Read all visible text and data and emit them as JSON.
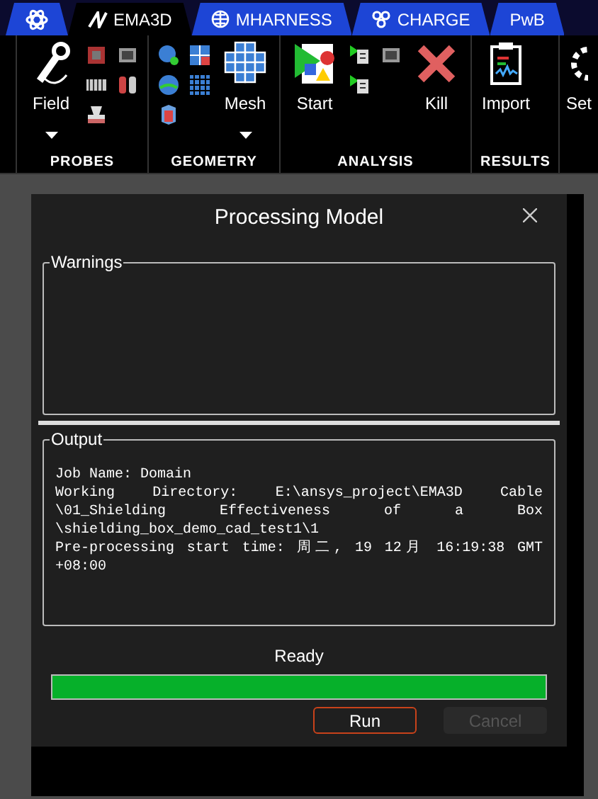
{
  "tabs": [
    {
      "kind": "logo",
      "selected": false
    },
    {
      "kind": "text",
      "label": "EMA3D",
      "selected": true
    },
    {
      "kind": "text",
      "label": "MHARNESS",
      "selected": false
    },
    {
      "kind": "text",
      "label": "CHARGE",
      "selected": false
    },
    {
      "kind": "text",
      "label": "PwB",
      "selected": false
    }
  ],
  "ribbon": {
    "groups": [
      {
        "label": "PROBES",
        "large": {
          "label": "Field",
          "dropdown": true
        }
      },
      {
        "label": "GEOMETRY",
        "large": {
          "label": "Mesh",
          "dropdown": true
        }
      },
      {
        "label": "ANALYSIS",
        "large": {
          "label": "Start",
          "dropdown": false
        },
        "extra": {
          "label": "Kill",
          "dropdown": false
        }
      },
      {
        "label": "RESULTS",
        "large": {
          "label": "Import",
          "dropdown": false
        }
      }
    ],
    "partial_button": {
      "label": "Set"
    }
  },
  "dialog": {
    "title": "Processing Model",
    "warnings": {
      "label": "Warnings"
    },
    "output": {
      "label": "Output",
      "lines": [
        {
          "text": "Job Name: Domain",
          "kind": "end"
        },
        {
          "text": "Working Directory: E:\\ansys_project\\EMA3D Cable",
          "kind": "wrapped"
        },
        {
          "text": "\\01_Shielding Effectiveness of a Box",
          "kind": "wrapped"
        },
        {
          "text": "\\shielding_box_demo_cad_test1\\1",
          "kind": "end"
        },
        {
          "text": "Pre-processing start time: 周二, 19 12月 16:19:38 GMT",
          "kind": "wrapped"
        },
        {
          "text": "+08:00",
          "kind": "end"
        }
      ]
    },
    "status": "Ready",
    "progress": {
      "level": 1
    },
    "buttons": [
      {
        "label": "Run",
        "focused": true,
        "disabled": false
      },
      {
        "label": "Cancel",
        "focused": false,
        "disabled": true
      }
    ]
  }
}
